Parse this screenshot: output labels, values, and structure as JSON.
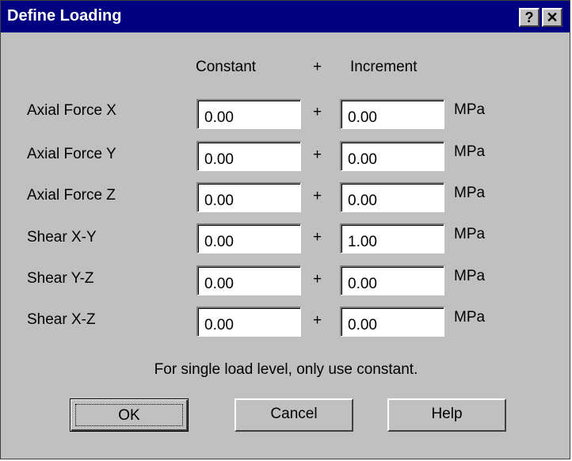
{
  "window": {
    "title": "Define Loading",
    "help_button": "?",
    "close_button": "✕"
  },
  "headers": {
    "constant": "Constant",
    "plus": "+",
    "increment": "Increment"
  },
  "rows": [
    {
      "label": "Axial Force X",
      "constant": "0.00",
      "plus": "+",
      "increment": "0.00",
      "unit": "MPa"
    },
    {
      "label": "Axial Force Y",
      "constant": "0.00",
      "plus": "+",
      "increment": "0.00",
      "unit": "MPa"
    },
    {
      "label": "Axial Force Z",
      "constant": "0.00",
      "plus": "+",
      "increment": "0.00",
      "unit": "MPa"
    },
    {
      "label": "Shear X-Y",
      "constant": "0.00",
      "plus": "+",
      "increment": "1.00",
      "unit": "MPa"
    },
    {
      "label": "Shear Y-Z",
      "constant": "0.00",
      "plus": "+",
      "increment": "0.00",
      "unit": "MPa"
    },
    {
      "label": "Shear X-Z",
      "constant": "0.00",
      "plus": "+",
      "increment": "0.00",
      "unit": "MPa"
    }
  ],
  "note": "For single load level, only use constant.",
  "buttons": {
    "ok": "OK",
    "cancel": "Cancel",
    "help": "Help"
  },
  "colors": {
    "titlebar": "#000080",
    "dialog_face": "#c0c0c0"
  }
}
